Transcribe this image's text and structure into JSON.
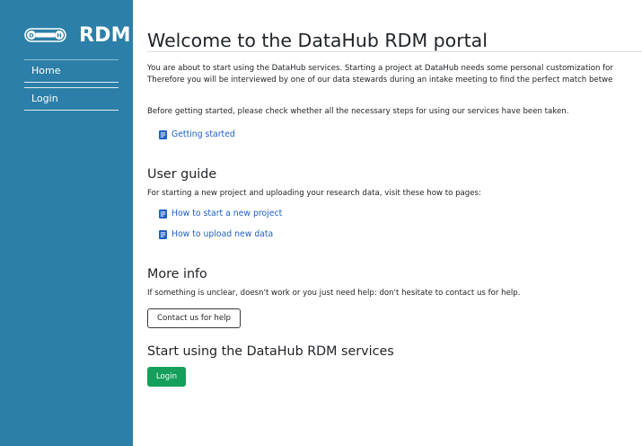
{
  "sidebar": {
    "brand": {
      "logo_icon": "datahub-logo-icon",
      "text": "RDM"
    },
    "items": [
      {
        "label": "Home"
      },
      {
        "label": "Login"
      }
    ]
  },
  "main": {
    "title": "Welcome to the DataHub RDM portal",
    "intro_line1": "You are about to start using the DataHub services. Starting a project at DataHub needs some personal customization for",
    "intro_line2": "Therefore you will be interviewed by one of our data stewards during an intake meeting to find the perfect match betwe",
    "before_text": "Before getting started, please check whether all the necessary steps for using our services have been taken.",
    "getting_started_link": "Getting started",
    "user_guide": {
      "heading": "User guide",
      "text": "For starting a new project and uploading your research data, visit these how to pages:",
      "links": [
        {
          "label": "How to start a new project"
        },
        {
          "label": "How to upload new data"
        }
      ]
    },
    "more_info": {
      "heading": "More info",
      "text": "If something is unclear, doesn't work or you just need help: don't hesitate to contact us for help.",
      "button": "Contact us for help"
    },
    "start": {
      "heading": "Start using the DataHub RDM services",
      "button": "Login"
    }
  },
  "colors": {
    "sidebar_bg": "#2b7fa8",
    "link": "#1f5fc4",
    "login_button": "#14a05a"
  }
}
